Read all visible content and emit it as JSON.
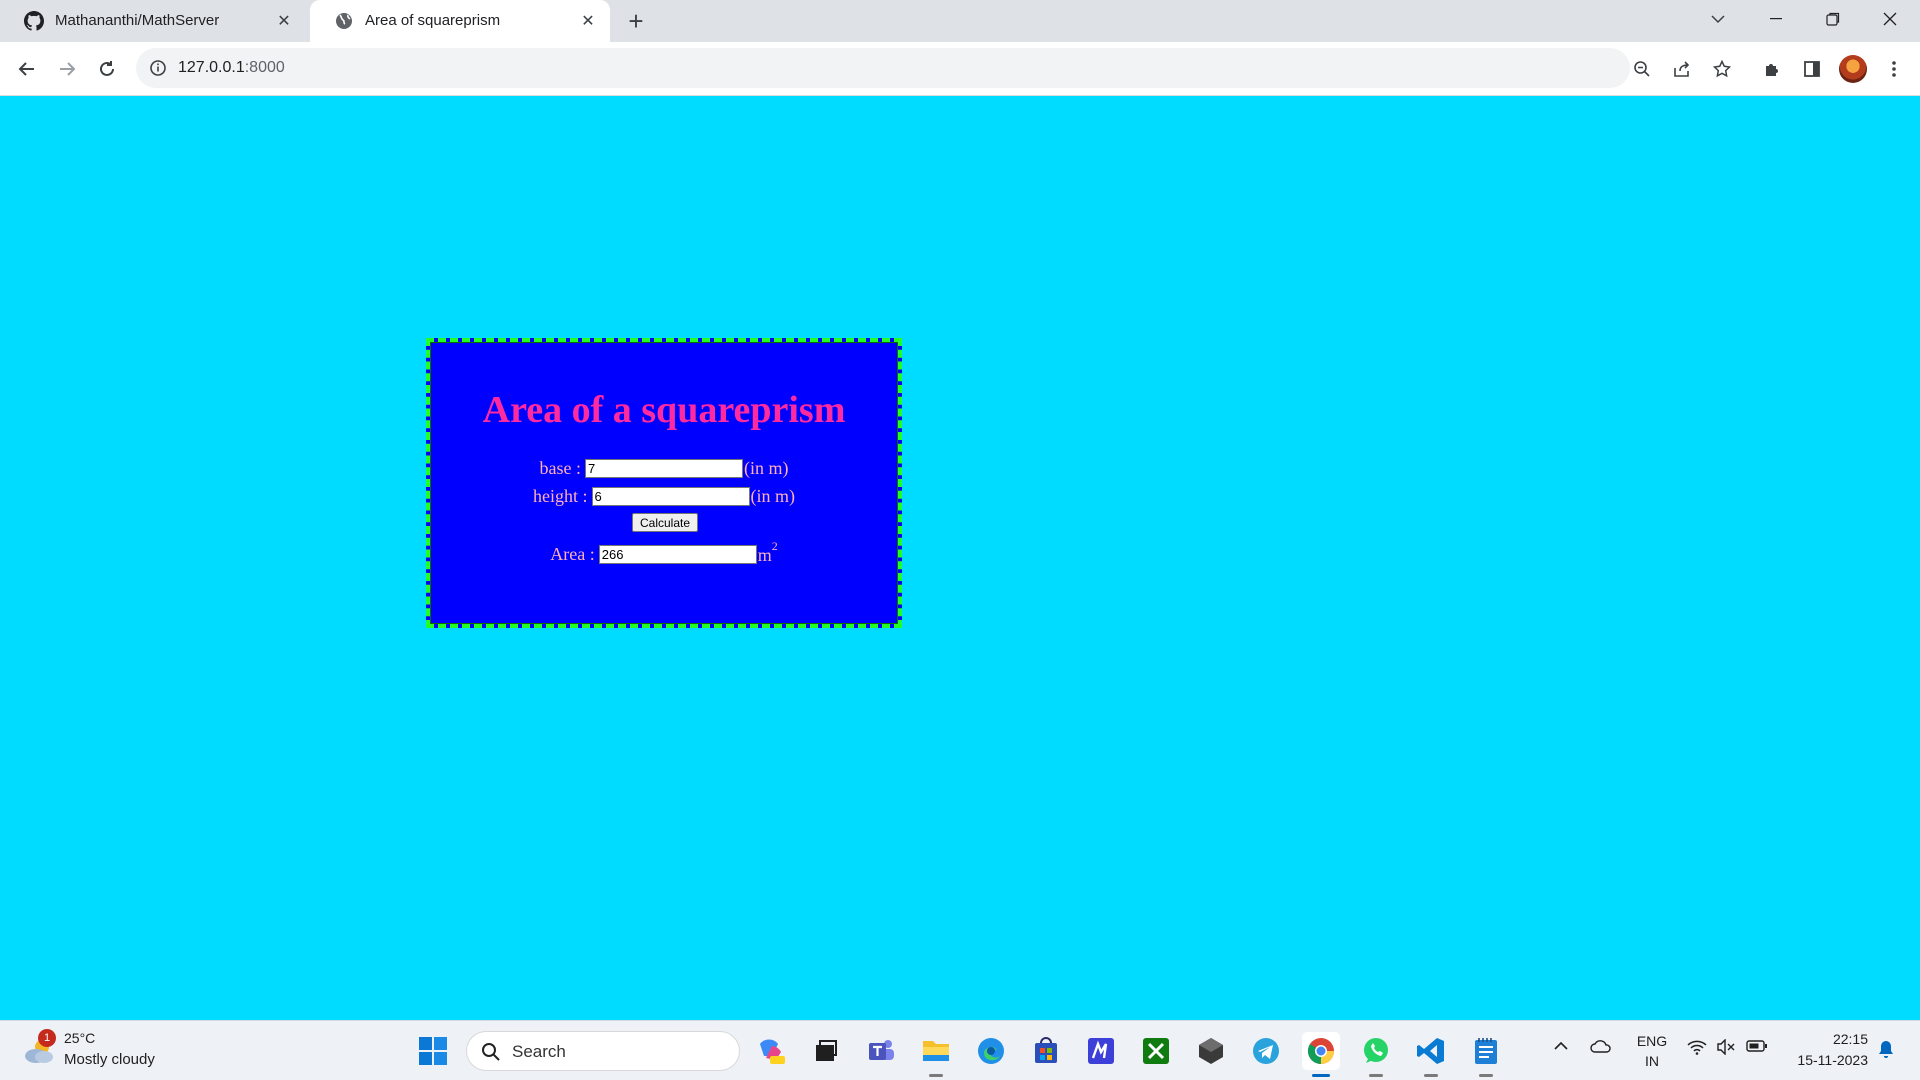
{
  "browser": {
    "tabs": [
      {
        "title": "Mathananthi/MathServer",
        "icon": "github-icon"
      },
      {
        "title": "Area of squareprism",
        "icon": "globe-icon"
      }
    ],
    "address": {
      "host": "127.0.0.1",
      "port": ":8000"
    }
  },
  "page": {
    "heading": "Area of a squareprism",
    "base": {
      "label": "base :",
      "value": "7",
      "unit": "(in m)"
    },
    "height": {
      "label": "height :",
      "value": "6",
      "unit": "(in m)"
    },
    "calculate_label": "Calculate",
    "area": {
      "label": "Area :",
      "value": "266",
      "unit": "m",
      "unit_sup": "2"
    },
    "colors": {
      "background": "#00dcff",
      "card": "#0000ff",
      "border": "#22ff22",
      "heading": "#ff2aa0",
      "label": "#ffb0b8"
    }
  },
  "taskbar": {
    "weather": {
      "temp": "25°C",
      "condition": "Mostly cloudy",
      "badge": "1"
    },
    "search_placeholder": "Search",
    "language": {
      "line1": "ENG",
      "line2": "IN"
    },
    "clock": {
      "time": "22:15",
      "date": "15-11-2023"
    }
  }
}
